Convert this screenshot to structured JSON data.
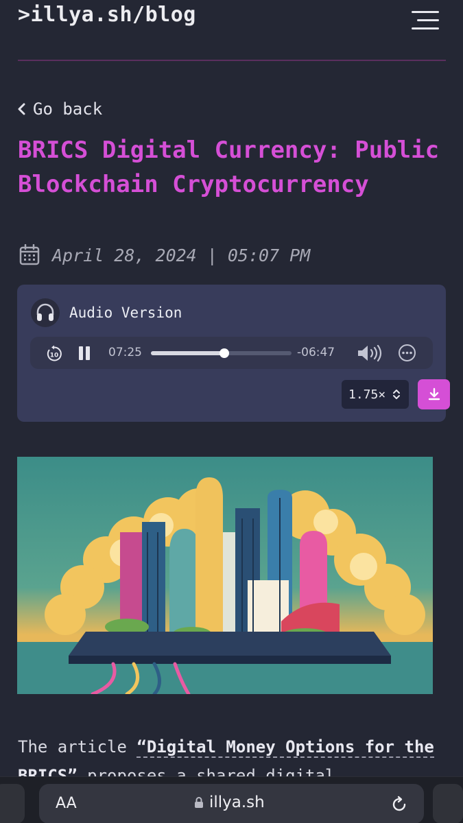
{
  "header": {
    "site_title": ">illya.sh/blog",
    "menu_icon": "hamburger-menu-icon"
  },
  "nav": {
    "back_label": "Go back",
    "back_icon": "chevron-left-icon"
  },
  "post": {
    "title": "BRICS Digital Currency: Public Blockchain Cryptocurrency",
    "date": "April 28, 2024 | 05:07 PM",
    "date_icon": "calendar-icon"
  },
  "audio": {
    "label": "Audio Version",
    "icon": "headphones-icon",
    "elapsed": "07:25",
    "remaining": "-06:47",
    "progress": 0.52,
    "speed": "1.75×",
    "controls": [
      "rewind-10-icon",
      "pause-icon",
      "volume-icon",
      "more-icon",
      "download-icon"
    ]
  },
  "hero_image": {
    "description": "Stylized illustration of futuristic city skyline on a platform with clouds, circuit-board foreground",
    "colors": [
      "#3f8f88",
      "#f3c25b",
      "#e85ba3",
      "#234a6e"
    ]
  },
  "article": {
    "intro_before": "The article ",
    "intro_link": "“Digital Money Options for the BRICS”",
    "intro_after": " proposes a shared digital"
  },
  "browser": {
    "text_size_label": "AA",
    "url": "illya.sh",
    "lock_icon": "lock-icon",
    "reload_icon": "reload-icon"
  },
  "colors": {
    "background": "#242734",
    "accent": "#d54fd6",
    "card": "#383c5b",
    "divider": "#5b2f5e"
  }
}
